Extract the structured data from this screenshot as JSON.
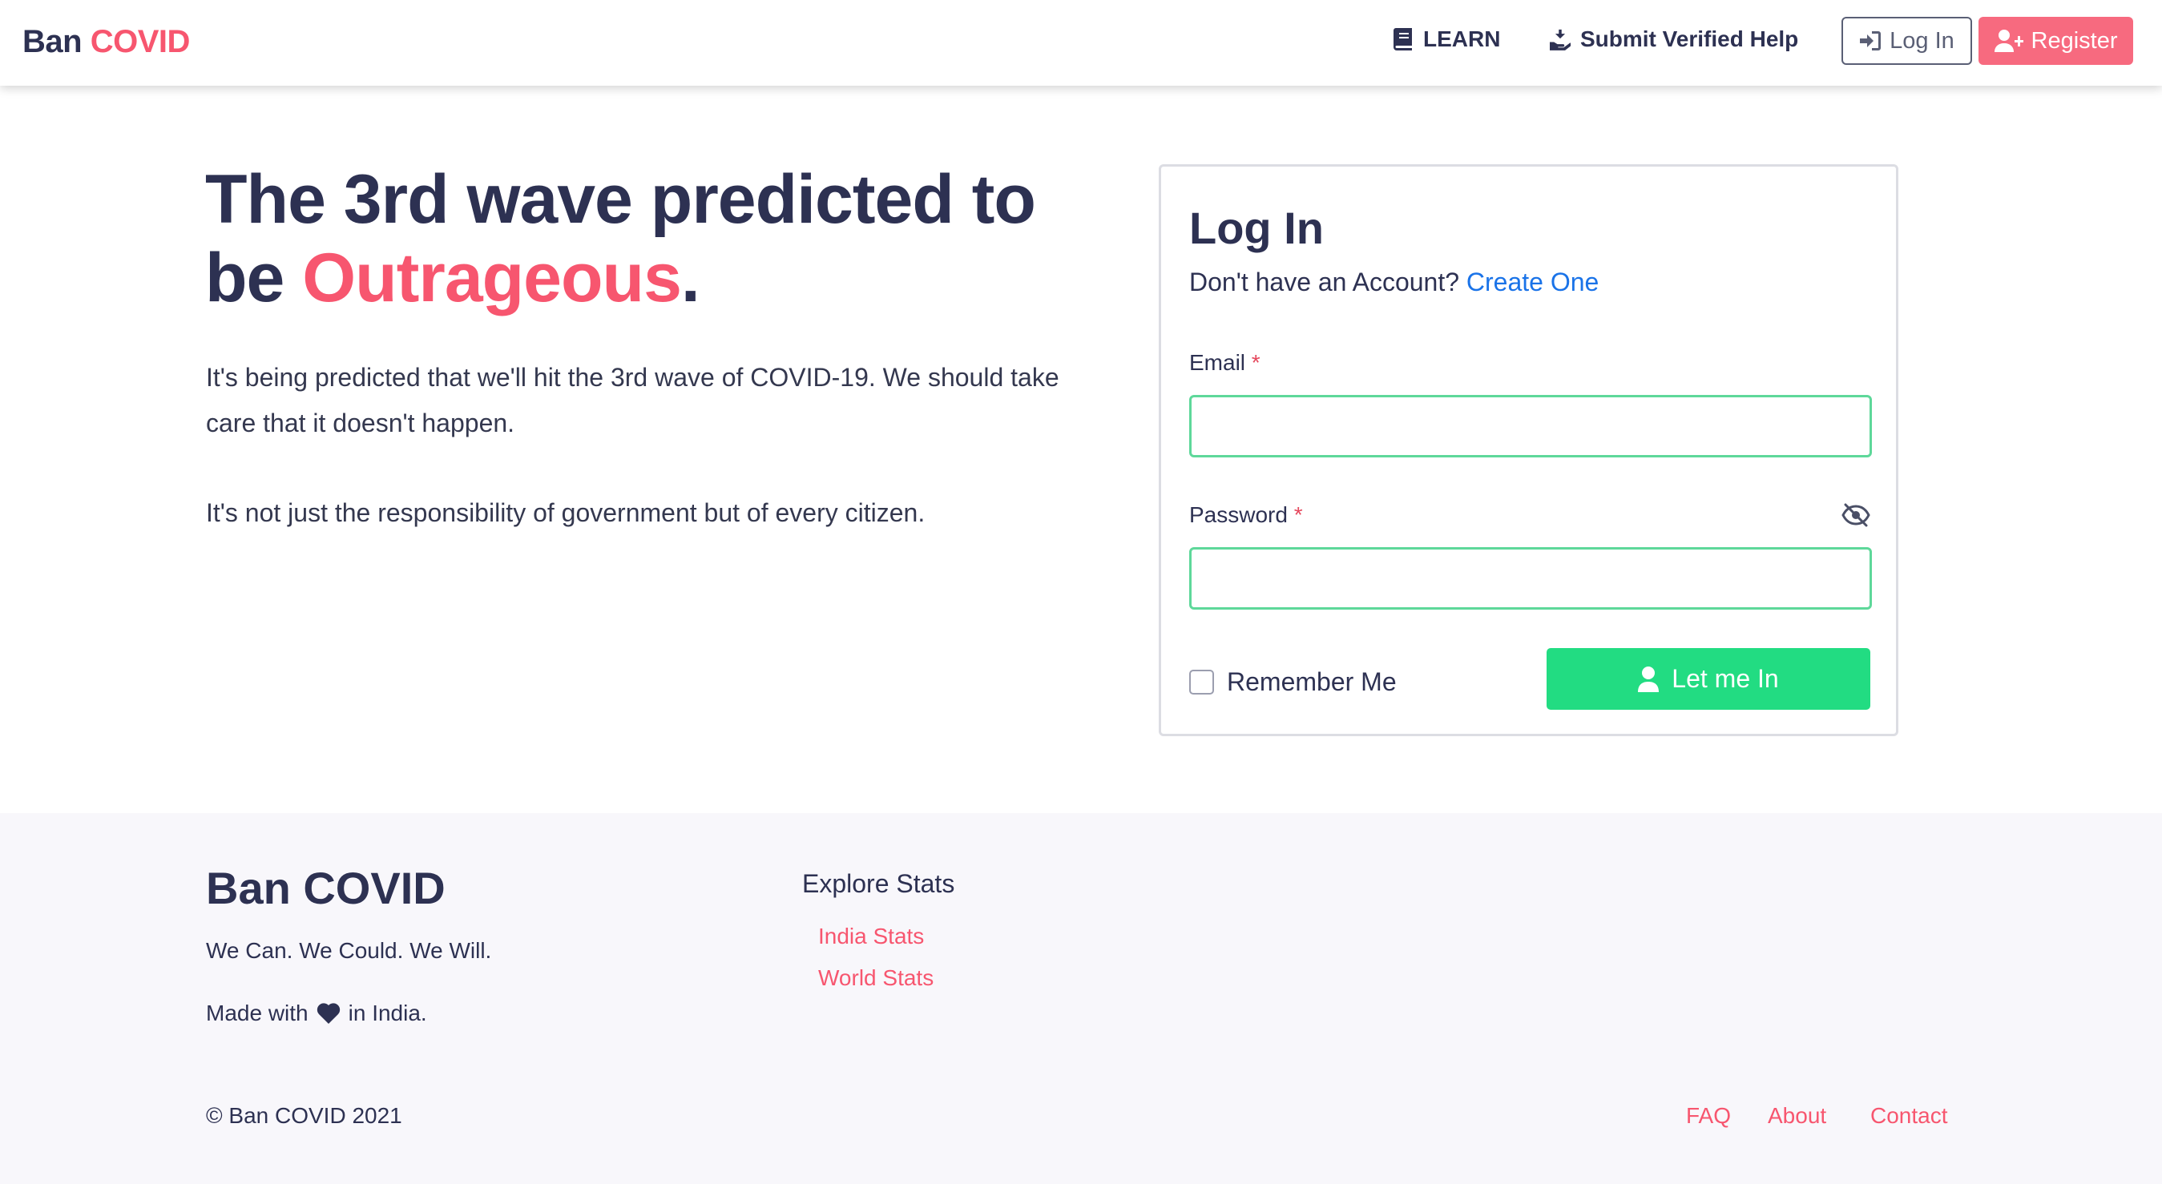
{
  "header": {
    "brand_main": "Ban",
    "brand_accent": "COVID",
    "nav": {
      "learn": "LEARN",
      "submit_help": "Submit Verified Help"
    },
    "login_button": "Log In",
    "register_button": "Register"
  },
  "hero": {
    "title_part1": "The 3rd wave predicted to be",
    "title_accent": "Outrageous",
    "title_end": ".",
    "paragraph1": "It's being predicted that we'll hit the 3rd wave of COVID-19. We should take care that it doesn't happen.",
    "paragraph2": "It's not just the responsibility of government but of every citizen."
  },
  "login_card": {
    "title": "Log In",
    "subtitle_prefix": "Don't have an Account?",
    "create_link": "Create One",
    "email_label": "Email",
    "password_label": "Password",
    "required_mark": "*",
    "email_value": "",
    "password_value": "",
    "remember_label": "Remember Me",
    "remember_checked": false,
    "submit_label": "Let me In"
  },
  "footer": {
    "brand": "Ban COVID",
    "tagline": "We Can. We Could. We Will.",
    "made_prefix": "Made with",
    "made_suffix": "in India.",
    "explore_heading": "Explore Stats",
    "explore_links": [
      "India Stats",
      "World Stats"
    ],
    "copyright": "© Ban COVID 2021",
    "bottom_links": [
      "FAQ",
      "About",
      "Contact"
    ]
  },
  "colors": {
    "accent": "#f7566f",
    "text": "#2d3152",
    "success": "#22dc82",
    "input_border": "#5ed89a",
    "link": "#1a73e8"
  }
}
